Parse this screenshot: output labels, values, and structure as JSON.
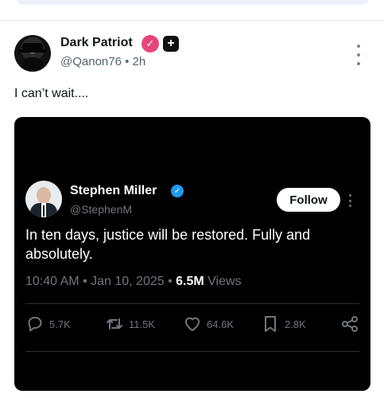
{
  "post": {
    "author_name": "Dark Patriot",
    "handle": "@Qanon76",
    "time": "2h",
    "text": "I can’t wait...."
  },
  "embedded": {
    "author_name": "Stephen Miller",
    "handle": "@StephenM",
    "follow_label": "Follow",
    "text": "In ten days, justice will be restored. Fully and absolutely.",
    "time": "10:40 AM",
    "date": "Jan 10, 2025",
    "views_count": "6.5M",
    "views_label": "Views",
    "stats": {
      "replies": "5.7K",
      "reposts": "11.5K",
      "likes": "64.6K",
      "bookmarks": "2.8K"
    }
  },
  "colors": {
    "pink_badge": "#e8457a",
    "blue_badge": "#1d9bf0",
    "card_bg": "#000000"
  },
  "icons": [
    "verified-pink-icon",
    "plus-icon",
    "more-vertical-icon",
    "verified-blue-icon",
    "reply-icon",
    "repost-icon",
    "like-icon",
    "bookmark-icon",
    "share-icon"
  ]
}
